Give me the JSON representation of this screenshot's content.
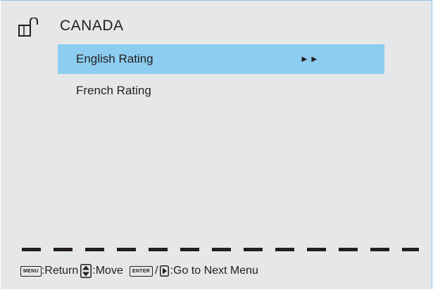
{
  "header": {
    "title": "CANADA",
    "icon": "unlocked-padlock-icon"
  },
  "menu": {
    "items": [
      {
        "label": "English Rating",
        "arrow": "►►",
        "selected": true
      },
      {
        "label": "French Rating",
        "arrow": "",
        "selected": false
      }
    ]
  },
  "help": {
    "menu_key": "MENU",
    "return_label": ":Return",
    "move_label": ":Move",
    "enter_key": "ENTER",
    "slash": "/",
    "next_label": ":Go to Next Menu"
  },
  "colors": {
    "background": "#e6e7e8",
    "highlight": "#8ccdf0",
    "border": "#8dc4ea",
    "text": "#231f20"
  }
}
